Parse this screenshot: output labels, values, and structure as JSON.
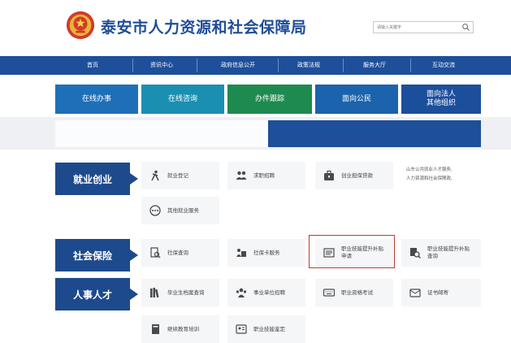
{
  "header": {
    "title": "泰安市人力资源和社会保障局",
    "search_placeholder": "请输入关键字"
  },
  "nav": [
    "首页",
    "资讯中心",
    "政府信息公开",
    "政策法规",
    "服务大厅",
    "互动交流"
  ],
  "tiles": [
    {
      "lines": [
        "在线办事"
      ],
      "color": "#1f6fb8"
    },
    {
      "lines": [
        "在线咨询"
      ],
      "color": "#1a8fb2"
    },
    {
      "lines": [
        "办件跟踪"
      ],
      "color": "#1e8a4f"
    },
    {
      "lines": [
        "面向公民"
      ],
      "color": "#1b63ad"
    },
    {
      "lines": [
        "面向法人",
        "其他组织"
      ],
      "color": "#1c4f9b"
    }
  ],
  "categories": {
    "employment": "就业创业",
    "social_insurance": "社会保险",
    "talent": "人事人才"
  },
  "employment_items": [
    "就业登记",
    "求职招聘",
    "创业担保贷款",
    "其他就业服务"
  ],
  "employment_note": [
    "山东公共就业人才服务,",
    "人力资源和社会保障政,"
  ],
  "insurance_items": [
    "社保查询",
    "社保卡服务",
    "职业技能提升补贴申请",
    "职业技能提升补贴查询"
  ],
  "talent_items": [
    "毕业生档案查询",
    "事业单位招聘",
    "职业资格考试",
    "证书邮寄",
    "继续教育培训",
    "职业技能鉴定"
  ],
  "colors": {
    "nav": "#1e4f9a",
    "category": "#1d4a8c",
    "highlight": "#c0392b"
  }
}
